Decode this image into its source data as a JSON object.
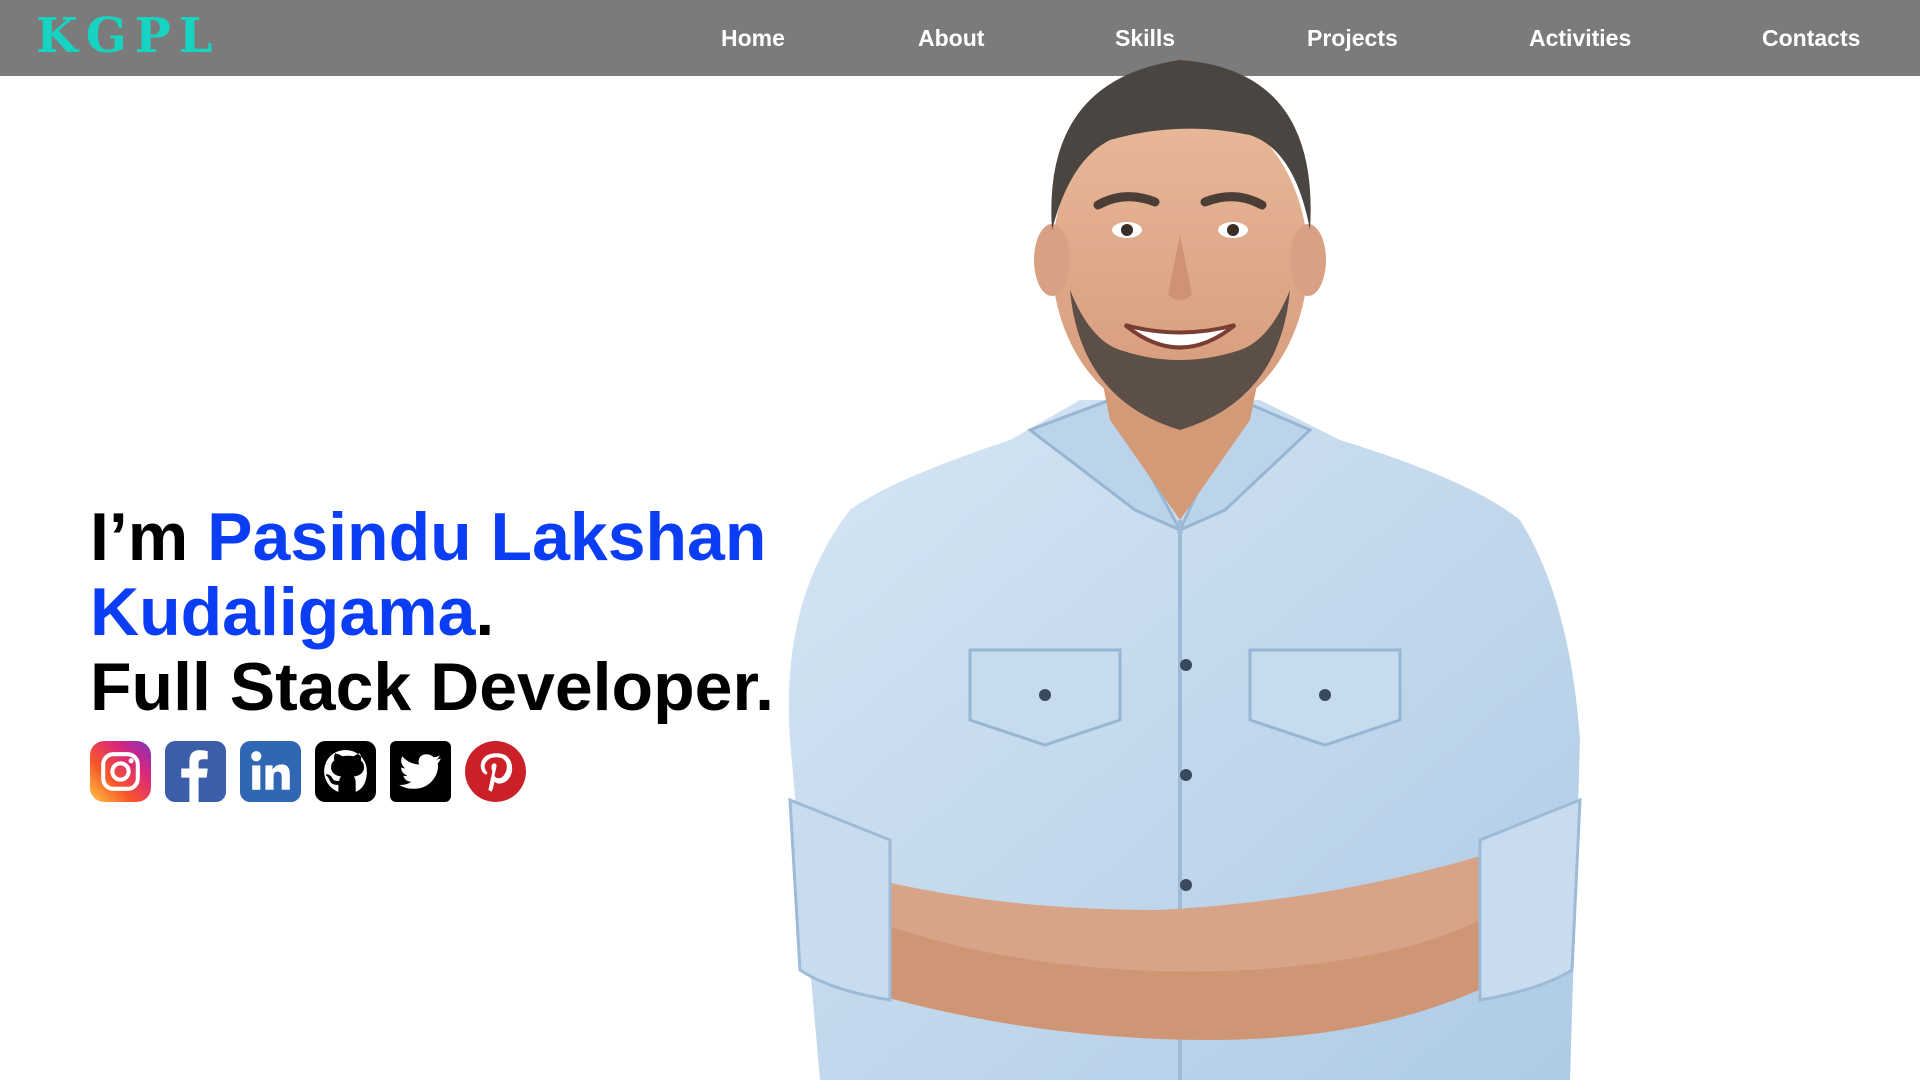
{
  "header": {
    "logo": "KGPL",
    "nav": [
      {
        "label": "Home"
      },
      {
        "label": "About"
      },
      {
        "label": "Skills"
      },
      {
        "label": "Projects"
      },
      {
        "label": "Activities"
      },
      {
        "label": "Contacts"
      }
    ]
  },
  "hero": {
    "greeting": "I’m ",
    "name_line1": "Pasindu Lakshan",
    "name_line2": "Kudaligama",
    "name_period": ".",
    "role": "Full Stack Developer.",
    "photo": "smiling-man-in-light-blue-denim-shirt-arms-crossed"
  },
  "social": [
    {
      "name": "Instagram",
      "icon": "instagram-icon"
    },
    {
      "name": "Facebook",
      "icon": "facebook-icon"
    },
    {
      "name": "LinkedIn",
      "icon": "linkedin-icon"
    },
    {
      "name": "GitHub",
      "icon": "github-icon"
    },
    {
      "name": "Twitter",
      "icon": "twitter-icon"
    },
    {
      "name": "Pinterest",
      "icon": "pinterest-icon"
    }
  ],
  "colors": {
    "header_bg": "#7b7b7b",
    "logo": "#17d4c2",
    "name_accent": "#0b3df5",
    "text": "#000000",
    "background": "#ffffff"
  }
}
